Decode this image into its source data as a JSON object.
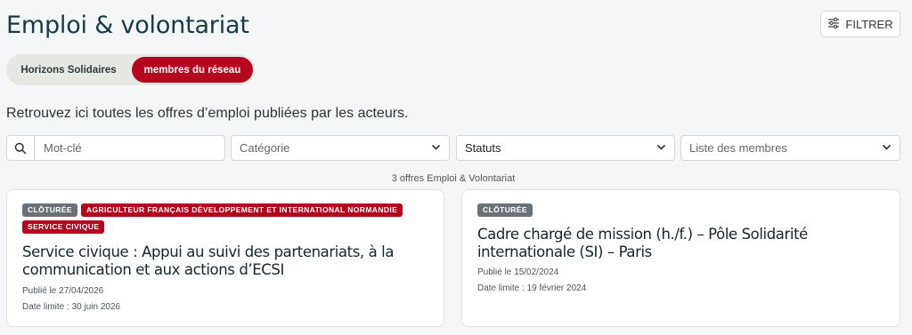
{
  "page": {
    "title": "Emploi & volontariat",
    "filter_label": "FILTRER",
    "intro": "Retrouvez ici toutes les offres d’emploi publiées par les acteurs."
  },
  "toggle": {
    "options": [
      {
        "label": "Horizons Solidaires",
        "active": false
      },
      {
        "label": "membres du réseau",
        "active": true
      }
    ]
  },
  "filters": {
    "keyword_placeholder": "Mot-clé",
    "category": "Catégorie",
    "status": "Statuts",
    "members": "Liste des membres"
  },
  "results": {
    "count_text": "3 offres Emploi & Volontariat"
  },
  "offers": [
    {
      "badges": [
        "CLÔTURÉE",
        "AGRICULTEUR FRANÇAIS DÉVELOPPEMENT ET INTERNATIONAL NORMANDIE",
        "SERVICE CIVIQUE"
      ],
      "title": "Service civique : Appui au suivi des partenariats, à la communication et aux actions d’ECSI",
      "published": "Publié le 27/04/2026",
      "deadline": "Date limite : 30 juin 2026"
    },
    {
      "badges": [
        "CLÔTURÉE"
      ],
      "title": "Cadre chargé de mission (h./f.) – Pôle Solidarité internationale (SI) – Paris",
      "published": "Publié le 15/02/2024",
      "deadline": "Date limite : 19 février 2024"
    }
  ],
  "colors": {
    "accent": "#b5051f",
    "badge_grey": "#6b7277",
    "title": "#183b43"
  }
}
